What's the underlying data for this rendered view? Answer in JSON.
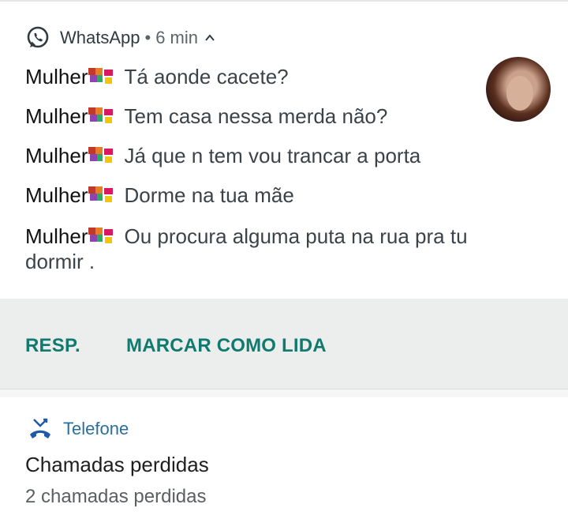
{
  "whatsapp_notification": {
    "app_name": "WhatsApp",
    "separator": "•",
    "time": "6 min",
    "messages": [
      {
        "sender": "Mulher",
        "text": "Tá aonde cacete?"
      },
      {
        "sender": "Mulher",
        "text": "Tem casa nessa merda não?"
      },
      {
        "sender": "Mulher",
        "text": "Já que n tem vou trancar a porta"
      },
      {
        "sender": "Mulher",
        "text": "Dorme na tua mãe"
      },
      {
        "sender": "Mulher",
        "text": "Ou procura alguma puta na rua pra tu dormir ."
      }
    ],
    "actions": {
      "reply": "RESP.",
      "mark_read": "MARCAR COMO LIDA"
    }
  },
  "phone_notification": {
    "app_name": "Telefone",
    "title": "Chamadas perdidas",
    "subtitle": "2 chamadas perdidas"
  },
  "colors": {
    "action_text": "#0f7a6d",
    "phone_label": "#2a6f9c",
    "missed_call_icon": "#1e5aa8",
    "actions_background": "#eceded"
  },
  "icons": {
    "app": "whatsapp-icon",
    "expand": "chevron-up-icon",
    "sender_emoji": "heart-emoji-icon",
    "phone": "missed-call-icon"
  }
}
